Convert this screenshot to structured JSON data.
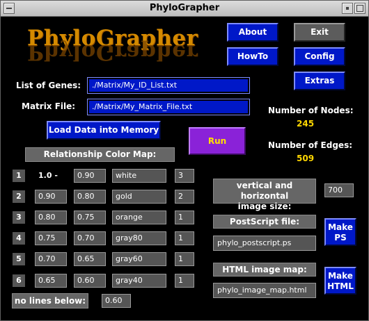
{
  "window": {
    "title": "PhyloGrapher"
  },
  "logo": {
    "text": "PhyloGrapher"
  },
  "buttons": {
    "about": "About",
    "exit": "Exit",
    "howto": "HowTo",
    "config": "Config",
    "extras": "Extras",
    "load": "Load Data into Memory",
    "run": "Run",
    "make_ps": "Make PS",
    "make_html": "Make HTML"
  },
  "inputs": {
    "genes_label": "List of Genes:",
    "genes_value": "./Matrix/My_ID_List.txt",
    "matrix_label": "Matrix File:",
    "matrix_value": "./Matrix/My_Matrix_File.txt"
  },
  "stats": {
    "nodes_label": "Number of Nodes:",
    "nodes_value": "245",
    "edges_label": "Number of Edges:",
    "edges_value": "509"
  },
  "color_map": {
    "title": "Relationship Color Map:",
    "rows": [
      {
        "index": "1",
        "upper": "1.0 -",
        "lower": "0.90",
        "color": "white",
        "width": "3"
      },
      {
        "index": "2",
        "upper": "0.90",
        "lower": "0.80",
        "color": "gold",
        "width": "2"
      },
      {
        "index": "3",
        "upper": "0.80",
        "lower": "0.75",
        "color": "orange",
        "width": "1"
      },
      {
        "index": "4",
        "upper": "0.75",
        "lower": "0.70",
        "color": "gray80",
        "width": "1"
      },
      {
        "index": "5",
        "upper": "0.70",
        "lower": "0.65",
        "color": "gray60",
        "width": "1"
      },
      {
        "index": "6",
        "upper": "0.65",
        "lower": "0.60",
        "color": "gray40",
        "width": "1"
      }
    ],
    "no_lines_label": "no lines below:",
    "no_lines_value": "0.60"
  },
  "output": {
    "size_label_line1": "vertical and horizontal",
    "size_label_line2": "image size:",
    "size_value": "700",
    "ps_label": "PostScript file:",
    "ps_value": "phylo_postscript.ps",
    "html_label": "HTML image map:",
    "html_value": "phylo_image_map.html"
  }
}
